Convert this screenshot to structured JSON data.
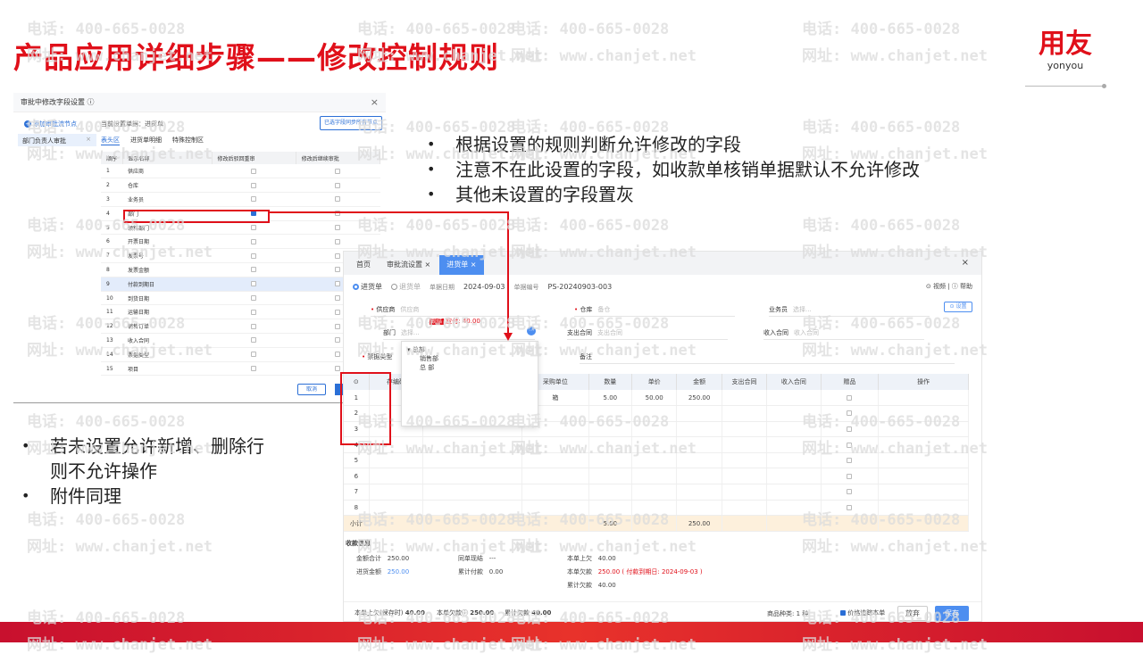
{
  "slide": {
    "title": "产品应用详细步骤——修改控制规则",
    "logo_cn": "用友",
    "logo_en": "yonyou",
    "watermark_phone": "电话: 400-665-0028",
    "watermark_url": "网址: www.chanjet.net",
    "bullets_right": [
      "根据设置的规则判断允许修改的字段",
      "注意不在此设置的字段，如收款单核销单据默认不允许修改",
      "其他未设置的字段置灰"
    ],
    "bullets_left": [
      "若未设置允许新增、删除行",
      "则不允许操作",
      "附件同理"
    ]
  },
  "dialog": {
    "title": "审批中修改字段设置 ⓘ",
    "add_node": "添加审批流节点",
    "left_item": "部门负责人审批",
    "current_type": "当前设置单据：进货单",
    "sync_button": "已选字段同步所有节点",
    "tabs": [
      "表头区",
      "进货单明细",
      "特殊控制区"
    ],
    "columns": [
      "顺序",
      "显示名称",
      "修改后驳回重审",
      "修改后继续审批"
    ],
    "rows": [
      {
        "n": "1",
        "name": "供应商",
        "a": false,
        "b": false
      },
      {
        "n": "2",
        "name": "仓库",
        "a": false,
        "b": false
      },
      {
        "n": "3",
        "name": "业务员",
        "a": false,
        "b": false
      },
      {
        "n": "4",
        "name": "部门",
        "a": true,
        "b": false
      },
      {
        "n": "5",
        "name": "领料部门",
        "a": false,
        "b": false
      },
      {
        "n": "6",
        "name": "开票日期",
        "a": false,
        "b": false
      },
      {
        "n": "7",
        "name": "发票号",
        "a": false,
        "b": false
      },
      {
        "n": "8",
        "name": "发票金额",
        "a": false,
        "b": false
      },
      {
        "n": "9",
        "name": "付款到期日",
        "a": false,
        "b": false
      },
      {
        "n": "10",
        "name": "到货日期",
        "a": false,
        "b": false
      },
      {
        "n": "11",
        "name": "运输日期",
        "a": false,
        "b": false
      },
      {
        "n": "12",
        "name": "销售订单",
        "a": false,
        "b": false
      },
      {
        "n": "13",
        "name": "收入合同",
        "a": false,
        "b": false
      },
      {
        "n": "14",
        "name": "票据类型",
        "a": false,
        "b": false
      },
      {
        "n": "15",
        "name": "项目",
        "a": false,
        "b": false
      }
    ],
    "cancel": "取消"
  },
  "app": {
    "tabs": [
      "首页",
      "审批流设置 ×",
      "进货单 ×"
    ],
    "doc_types": [
      "进货单",
      "退货单"
    ],
    "date_label": "单据日期",
    "date_value": "2024-09-03",
    "code_label": "单据编号",
    "code_value": "PS-20240903-003",
    "help": "⊙ 视频 | ⓘ 帮助",
    "set_button": "⊙ 设置",
    "fields": {
      "supplier": "供应商",
      "supplier_ph": "供应商",
      "warehouse": "仓库",
      "warehouse_ph": "备仓",
      "salesman": "业务员",
      "salesman_ph": "选择...",
      "dept": "部门",
      "dept_ph": "选择...",
      "pay_contract": "支出合同",
      "pay_contract_ph": "支出合同",
      "income_contract": "收入合同",
      "income_contract_ph": "收入合同",
      "bill_type": "票据类型",
      "remark": "备注",
      "badge": "现结",
      "badge_amount": "应付: 40.00"
    },
    "dropdown": [
      "总部",
      "销售部",
      "总 部"
    ],
    "grid_cols": [
      "⊙",
      "存编码",
      "",
      "采购单位",
      "数量",
      "单价",
      "金额",
      "支出合同",
      "收入合同",
      "赠品",
      "操作"
    ],
    "grid_row1": {
      "unit": "箱",
      "qty": "5.00",
      "price": "50.00",
      "amount": "250.00"
    },
    "grid_rows": [
      "1",
      "2",
      "3",
      "4",
      "5",
      "6",
      "7",
      "8"
    ],
    "subtotal_label": "小计",
    "subtotal_qty": "5.00",
    "subtotal_amount": "250.00",
    "summary": {
      "title": "收款信息",
      "total_label": "金额合计",
      "total": "250.00",
      "paid_label": "进货金额",
      "paid": "250.00",
      "rule_label": "同单现结",
      "rule": "---",
      "pay_label": "累计付款",
      "pay": "0.00",
      "prev_owe_label": "本单上欠",
      "prev_owe": "40.00",
      "owe_label": "本单欠款",
      "owe": "250.00",
      "due": "( 付款到期日: 2024-09-03 )",
      "acc_owe_label": "累计欠款",
      "acc_owe": "40.00"
    },
    "footer": {
      "f1_label": "本单上欠(保存时)",
      "f1": "40.00",
      "f2_label": "本单欠款ⓘ",
      "f2": "250.00",
      "f3_label": "累计欠款",
      "f3": "40.00",
      "kinds_label": "商品种类:",
      "kinds": "1 种",
      "trace_label": "价格追踪本单",
      "abandon": "放弃",
      "save": "保存"
    }
  }
}
